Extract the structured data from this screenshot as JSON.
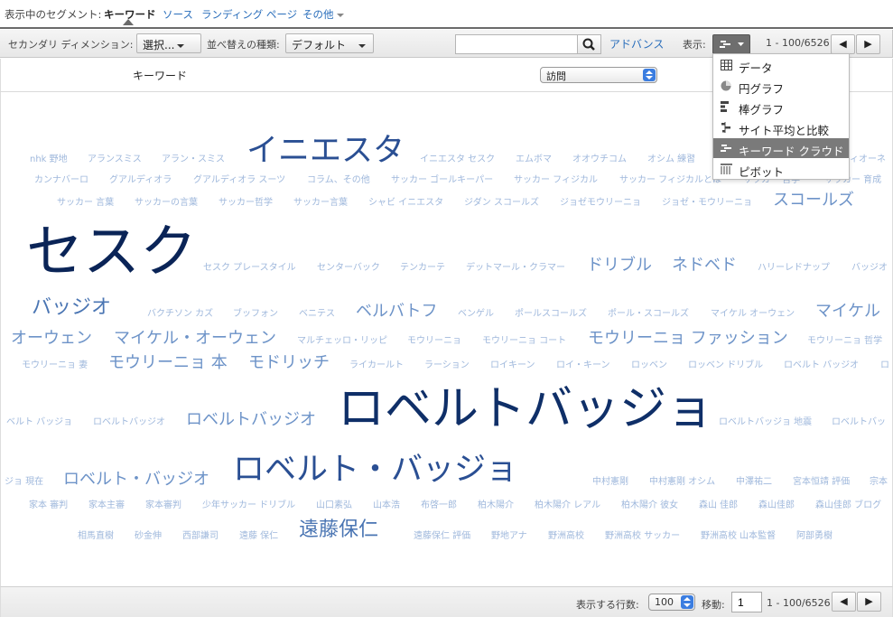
{
  "segment_bar": {
    "label": "表示中のセグメント:",
    "items": [
      "キーワード",
      "ソース",
      "ランディング ページ",
      "その他"
    ]
  },
  "toolbar": {
    "secondary_dimension_label": "セカンダリ ディメンション:",
    "secondary_dimension_value": "選択...",
    "sort_type_label": "並べ替えの種類:",
    "sort_type_value": "デフォルト",
    "search_value": "",
    "advanced_label": "アドバンス",
    "view_label": "表示:",
    "pagination": "1 - 100/6526",
    "prev_label": "◀",
    "next_label": "▶"
  },
  "table_header": {
    "keyword_column": "キーワード",
    "metric_value": "訪問"
  },
  "view_menu": {
    "items": [
      "データ",
      "円グラフ",
      "棒グラフ",
      "サイト平均と比較",
      "キーワード クラウド",
      "ピボット"
    ],
    "active_index": 4
  },
  "cloud": {
    "words": [
      "nhk 野地",
      "アランスミス",
      "アラン・スミス",
      "イニエスタ",
      "イニエスタ セスク",
      "エムボマ",
      "オオウチコム",
      "オシム 練習",
      "ヴィオーネ",
      "カンナバーロ",
      "グアルディオラ",
      "グアルディオラ スーツ",
      "コラム、その他",
      "サッカー ゴールキーパー",
      "サッカー フィジカル",
      "サッカー フィジカルとは",
      "サッカー 哲学",
      "サッカー 育成",
      "サッカー 言葉",
      "サッカーの言葉",
      "サッカー哲学",
      "サッカー言葉",
      "シャビ イニエスタ",
      "ジダン スコールズ",
      "ジョゼモウリーニョ",
      "ジョゼ・モウリーニョ",
      "スコールズ",
      "セスク",
      "セスク プレースタイル",
      "センターバック",
      "テンカーテ",
      "デットマール・クラマー",
      "ドリブル",
      "ネドベド",
      "ハリーレドナップ",
      "バッジオ",
      "バッジオ",
      "バクチソン カズ",
      "ブッフォン",
      "ベニテス",
      "ベルバトフ",
      "ベンゲル",
      "ポールスコールズ",
      "ポール・スコールズ",
      "マイケル オーウェン",
      "マイケル",
      "オーウェン",
      "マイケル・オーウェン",
      "マルチェッロ・リッピ",
      "モウリーニョ",
      "モウリーニョ コート",
      "モウリーニョ ファッション",
      "モウリーニョ 哲学",
      "モウリーニョ 妻",
      "モウリーニョ 本",
      "モドリッチ",
      "ライカールト",
      "ラーション",
      "ロイキーン",
      "ロイ・キーン",
      "ロッベン",
      "ロッベン ドリブル",
      "ロベルト バッジオ",
      "ロ",
      "ベルト バッジョ",
      "ロベルトバッジオ",
      "ロベルトバッジオ",
      "ロベルトバッジョ",
      "ロベルトバッジョ 地震",
      "ロベルトバッ",
      "ジョ 現在",
      "ロベルト・バッジオ",
      "ロベルト・バッジョ",
      "中村憲剛",
      "中村憲剛 オシム",
      "中澤祐二",
      "宮本恒靖 評価",
      "宗本",
      "家本 審判",
      "家本主審",
      "家本審判",
      "少年サッカー ドリブル",
      "山口素弘",
      "山本浩",
      "布啓一郎",
      "柏木陽介",
      "柏木陽介 レアル",
      "柏木陽介 彼女",
      "森山 佳郎",
      "森山佳郎",
      "森山佳郎 ブログ",
      "相馬直樹",
      "砂金伸",
      "西部謙司",
      "遠藤 保仁",
      "遠藤保仁",
      "遠藤保仁 評価",
      "野地アナ",
      "野洲高校",
      "野洲高校 サッカー",
      "野洲高校 山本監督",
      "阿部勇樹"
    ]
  },
  "footer": {
    "rows_label": "表示する行数:",
    "rows_value": "100",
    "goto_label": "移動:",
    "goto_value": "1",
    "pagination": "1 - 100/6526",
    "prev_label": "◀",
    "next_label": "▶"
  }
}
